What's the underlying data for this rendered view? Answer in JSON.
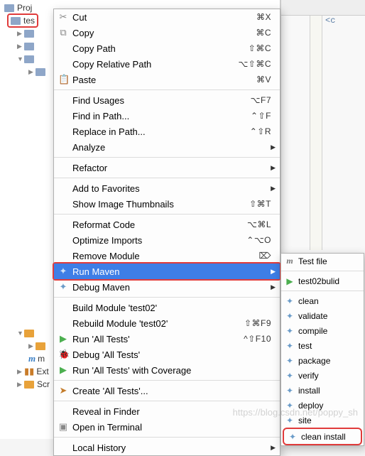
{
  "tree": {
    "proj_prefix": "Proj",
    "tes_label": "tes",
    "ext_label": "Ext",
    "scr_label": "Scr",
    "m_label": "m"
  },
  "editor": {
    "text": "<c"
  },
  "ctx": {
    "cut": "Cut",
    "cut_sc": "⌘X",
    "copy": "Copy",
    "copy_sc": "⌘C",
    "copy_path": "Copy Path",
    "copy_path_sc": "⇧⌘C",
    "copy_rel": "Copy Relative Path",
    "copy_rel_sc": "⌥⇧⌘C",
    "paste": "Paste",
    "paste_sc": "⌘V",
    "find_usages": "Find Usages",
    "find_usages_sc": "⌥F7",
    "find_in_path": "Find in Path...",
    "find_in_path_sc": "⌃⇧F",
    "replace_in_path": "Replace in Path...",
    "replace_in_path_sc": "⌃⇧R",
    "analyze": "Analyze",
    "refactor": "Refactor",
    "add_fav": "Add to Favorites",
    "show_thumb": "Show Image Thumbnails",
    "show_thumb_sc": "⇧⌘T",
    "reformat": "Reformat Code",
    "reformat_sc": "⌥⌘L",
    "optimize": "Optimize Imports",
    "optimize_sc": "⌃⌥O",
    "remove_mod": "Remove Module",
    "remove_mod_sc": "⌦",
    "run_maven": "Run Maven",
    "debug_maven": "Debug Maven",
    "build_mod": "Build Module 'test02'",
    "rebuild_mod": "Rebuild Module 'test02'",
    "rebuild_mod_sc": "⇧⌘F9",
    "run_all": "Run 'All Tests'",
    "run_all_sc": "^⇧F10",
    "debug_all": "Debug 'All Tests'",
    "run_cov": "Run 'All Tests' with Coverage",
    "create_all": "Create 'All Tests'...",
    "reveal": "Reveal in Finder",
    "open_term": "Open in Terminal",
    "local_hist": "Local History"
  },
  "sub": {
    "test_file": "Test file",
    "test_build": "test02bulid",
    "clean": "clean",
    "validate": "validate",
    "compile": "compile",
    "test": "test",
    "package": "package",
    "verify": "verify",
    "install": "install",
    "deploy": "deploy",
    "site": "site",
    "clean_install": "clean install"
  },
  "watermark": "https://blog.csdn.net/poppy_sh"
}
